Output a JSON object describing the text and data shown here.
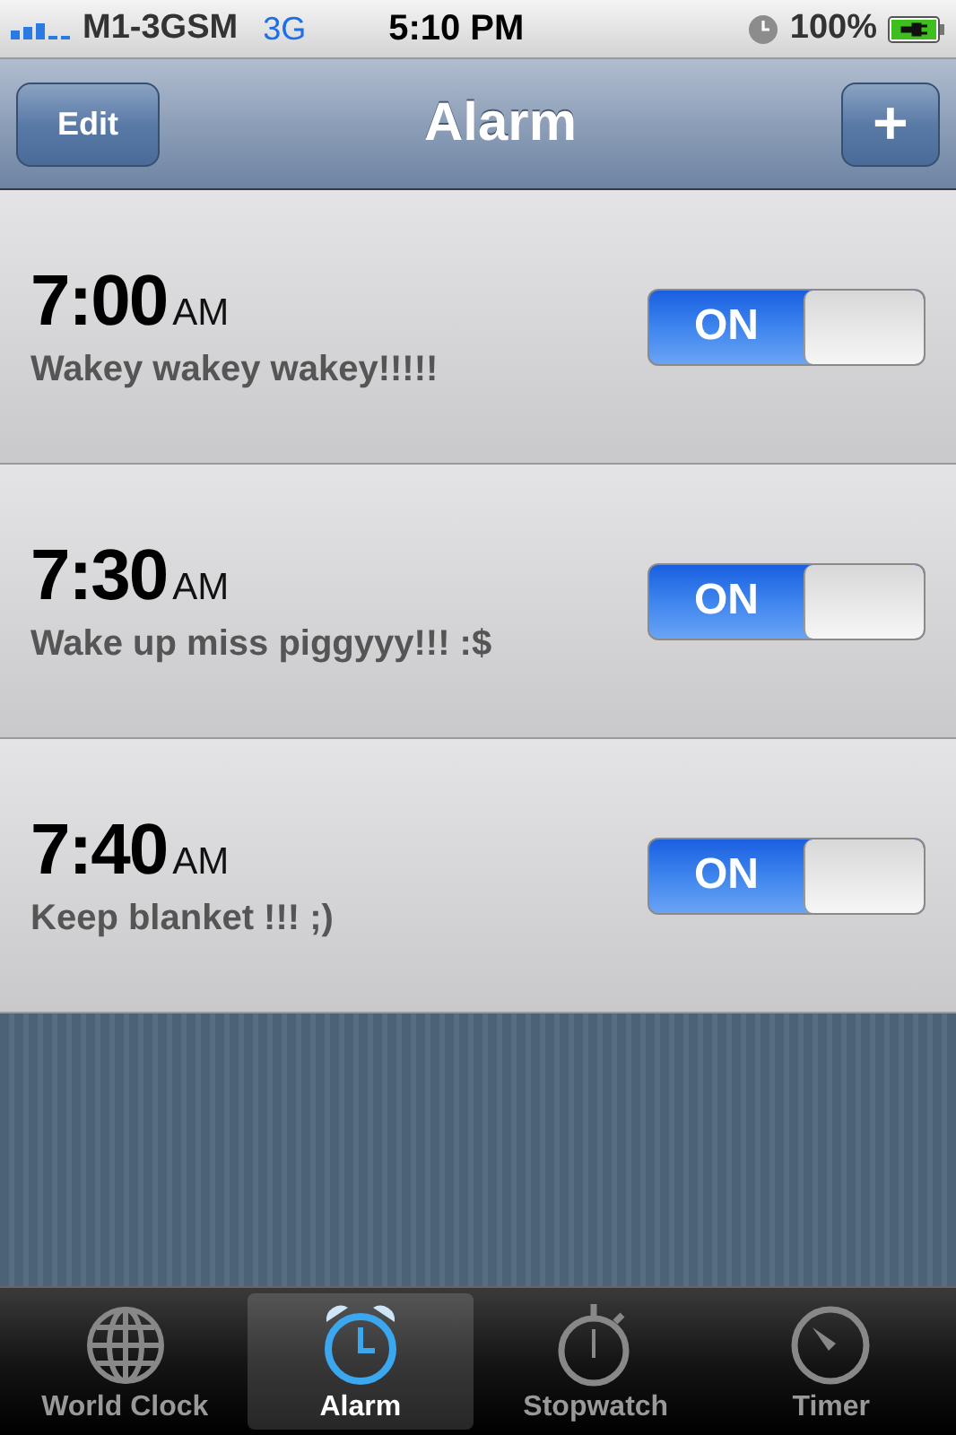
{
  "status_bar": {
    "carrier": "M1-3GSM",
    "network": "3G",
    "time": "5:10 PM",
    "battery": "100%"
  },
  "nav_bar": {
    "title": "Alarm",
    "left_button": "Edit",
    "right_button": "+"
  },
  "alarms": [
    {
      "time": "7:00",
      "period": "AM",
      "label": "Wakey wakey wakey!!!!!",
      "switch_text": "ON",
      "on": true
    },
    {
      "time": "7:30",
      "period": "AM",
      "label": "Wake up miss piggyyy!!! :$",
      "switch_text": "ON",
      "on": true
    },
    {
      "time": "7:40",
      "period": "AM",
      "label": "Keep blanket !!! ;)",
      "switch_text": "ON",
      "on": true
    }
  ],
  "tabs": [
    {
      "label": "World Clock",
      "selected": false
    },
    {
      "label": "Alarm",
      "selected": true
    },
    {
      "label": "Stopwatch",
      "selected": false
    },
    {
      "label": "Timer",
      "selected": false
    }
  ]
}
